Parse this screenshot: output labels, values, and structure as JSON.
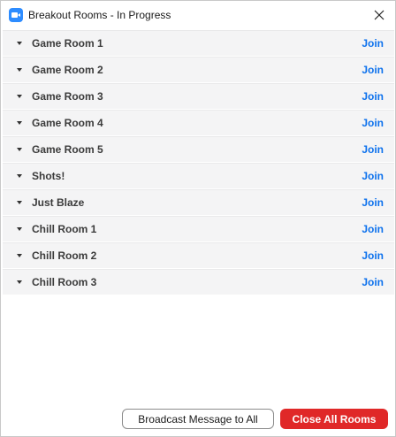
{
  "window": {
    "title": "Breakout Rooms - In Progress",
    "app_icon": "zoom-camera-icon",
    "close_icon": "close-icon"
  },
  "rooms": [
    {
      "name": "Game Room 1",
      "action": "Join"
    },
    {
      "name": "Game Room 2",
      "action": "Join"
    },
    {
      "name": "Game Room 3",
      "action": "Join"
    },
    {
      "name": "Game Room 4",
      "action": "Join"
    },
    {
      "name": "Game Room 5",
      "action": "Join"
    },
    {
      "name": "Shots!",
      "action": "Join"
    },
    {
      "name": "Just Blaze",
      "action": "Join"
    },
    {
      "name": "Chill Room 1",
      "action": "Join"
    },
    {
      "name": "Chill Room 2",
      "action": "Join"
    },
    {
      "name": "Chill Room 3",
      "action": "Join"
    }
  ],
  "footer": {
    "broadcast_label": "Broadcast Message to All",
    "close_all_label": "Close All Rooms"
  },
  "colors": {
    "accent_link": "#0e72ed",
    "danger": "#e02828",
    "row_bg": "#f4f4f5"
  }
}
